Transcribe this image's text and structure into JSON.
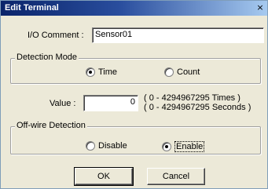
{
  "window": {
    "title": "Edit Terminal",
    "close_glyph": "×"
  },
  "io_comment": {
    "label": "I/O Comment :",
    "value": "Sensor01"
  },
  "detection_mode": {
    "legend": "Detection Mode",
    "options": [
      {
        "label": "Time",
        "selected": true
      },
      {
        "label": "Count",
        "selected": false
      }
    ]
  },
  "value_field": {
    "label": "Value :",
    "value": "0",
    "range_times": "( 0 - 4294967295 Times )",
    "range_seconds": "( 0 - 4294967295 Seconds )"
  },
  "offwire_detection": {
    "legend": "Off-wire Detection",
    "options": [
      {
        "label": "Disable",
        "selected": false
      },
      {
        "label": "Enable",
        "selected": true
      }
    ]
  },
  "buttons": {
    "ok": "OK",
    "cancel": "Cancel"
  }
}
